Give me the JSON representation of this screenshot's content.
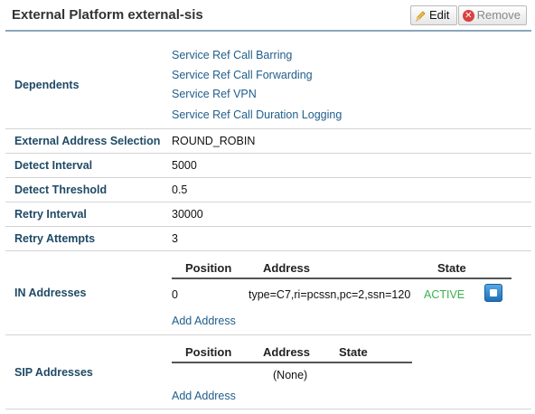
{
  "header": {
    "title": "External Platform external-sis",
    "edit_label": "Edit",
    "remove_label": "Remove"
  },
  "dependents": {
    "label": "Dependents",
    "links": [
      "Service Ref Call Barring",
      "Service Ref Call Forwarding",
      "Service Ref VPN",
      "Service Ref Call Duration Logging"
    ]
  },
  "fields": {
    "address_selection": {
      "label": "External Address Selection",
      "value": "ROUND_ROBIN"
    },
    "detect_interval": {
      "label": "Detect Interval",
      "value": "5000"
    },
    "detect_threshold": {
      "label": "Detect Threshold",
      "value": "0.5"
    },
    "retry_interval": {
      "label": "Retry Interval",
      "value": "30000"
    },
    "retry_attempts": {
      "label": "Retry Attempts",
      "value": "3"
    }
  },
  "in_addresses": {
    "label": "IN Addresses",
    "columns": [
      "Position",
      "Address",
      "State"
    ],
    "rows": [
      {
        "position": "0",
        "address": "type=C7,ri=pcssn,pc=2,ssn=120",
        "state": "ACTIVE"
      }
    ],
    "add_label": "Add Address"
  },
  "sip_addresses": {
    "label": "SIP Addresses",
    "columns": [
      "Position",
      "Address",
      "State"
    ],
    "empty_text": "(None)",
    "add_label": "Add Address"
  },
  "colors": {
    "label": "#1f4a66",
    "link": "#1f5e8c",
    "active_state": "#37b24d",
    "header_rule": "#8aa7bd"
  },
  "icons": {
    "edit": "pencil-icon",
    "remove": "x-circle-icon",
    "stop": "stop-icon"
  }
}
